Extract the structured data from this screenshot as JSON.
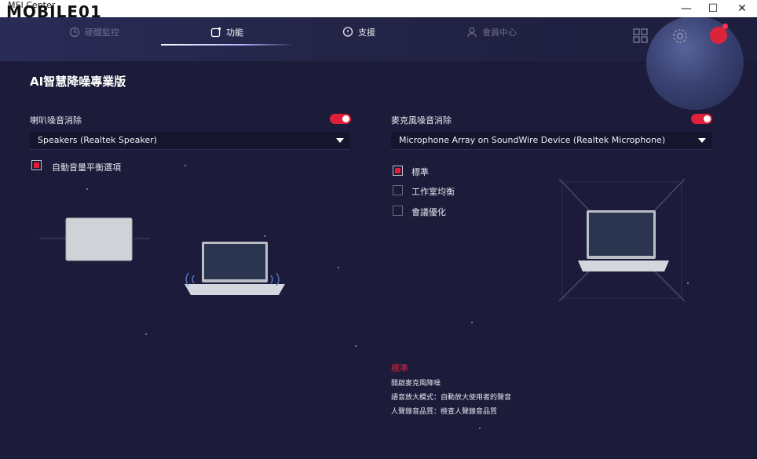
{
  "app": {
    "title": "MSI Center",
    "watermark": "MOBILE01"
  },
  "window_controls": {
    "minimize": "—",
    "maximize": "☐",
    "close": "✕"
  },
  "nav": [
    {
      "label": "硬體監控",
      "state": "dim"
    },
    {
      "label": "功能",
      "state": "active"
    },
    {
      "label": "支援",
      "state": "normal"
    },
    {
      "label": "會員中心",
      "state": "dim"
    }
  ],
  "page": {
    "title": "AI智慧降噪專業版"
  },
  "speaker": {
    "label": "喇叭噪音消除",
    "toggle_on": true,
    "device": "Speakers (Realtek Speaker)",
    "option_label": "自動音量平衡選項",
    "option_checked": true
  },
  "mic": {
    "label": "麥克風噪音消除",
    "toggle_on": true,
    "device": "Microphone Array on SoundWire Device (Realtek Microphone)",
    "modes": [
      {
        "label": "標準",
        "checked": true
      },
      {
        "label": "工作室均衡",
        "checked": false
      },
      {
        "label": "會議優化",
        "checked": false
      }
    ]
  },
  "description": {
    "title": "標準",
    "lines": [
      "開啟麥克風降噪",
      "語音放大模式：自動放大使用者的聲音",
      "人聲錄音品質：檢查人聲錄音品質"
    ]
  },
  "colors": {
    "accent": "#e0203a",
    "background": "#1c1c3a"
  }
}
